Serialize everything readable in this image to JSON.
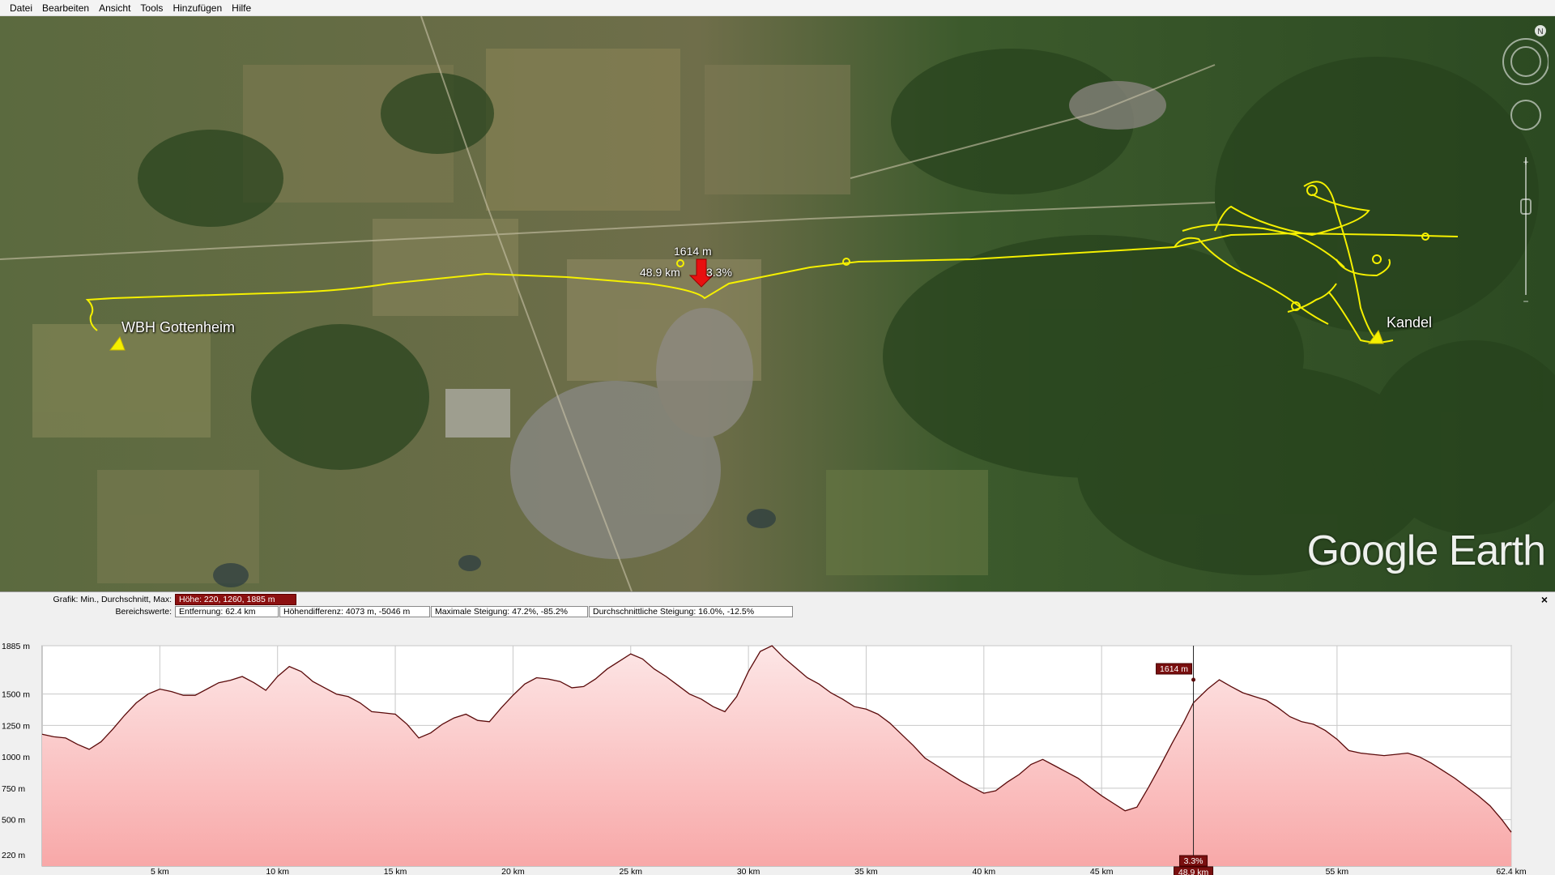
{
  "menu": {
    "items": [
      {
        "label": "Datei",
        "name": "menu-datei"
      },
      {
        "label": "Bearbeiten",
        "name": "menu-bearbeiten"
      },
      {
        "label": "Ansicht",
        "name": "menu-ansicht"
      },
      {
        "label": "Tools",
        "name": "menu-tools"
      },
      {
        "label": "Hinzufügen",
        "name": "menu-hinzufuegen"
      },
      {
        "label": "Hilfe",
        "name": "menu-hilfe"
      }
    ]
  },
  "map": {
    "places": {
      "start": "WBH Gottenheim",
      "end": "Kandel"
    },
    "cursor": {
      "elevation": "1614 m",
      "distance": "48.9 km",
      "slope": "3.3%"
    },
    "watermark": "Google Earth",
    "compass_letter": "N",
    "track_color": "#f5f000",
    "cursor_color": "#e81010"
  },
  "profile": {
    "row1": {
      "label": "Grafik: Min., Durchschnitt, Max:",
      "hoehe": "Höhe: 220, 1260, 1885 m"
    },
    "row2": {
      "label": "Bereichswerte:",
      "entfernung": "Entfernung: 62.4 km",
      "hoehendifferenz": "Höhendifferenz: 4073 m, -5046 m",
      "max_steigung": "Maximale Steigung: 47.2%, -85.2%",
      "avg_steigung": "Durchschnittliche Steigung: 16.0%, -12.5%"
    },
    "close_symbol": "×"
  },
  "chart_data": {
    "type": "area",
    "xlabel": "",
    "ylabel": "",
    "xlim": [
      0,
      62.4
    ],
    "ylim": [
      130,
      1885
    ],
    "y_ticks": [
      {
        "label": "1885 m",
        "value": 1885
      },
      {
        "label": "1500 m",
        "value": 1500
      },
      {
        "label": "1250 m",
        "value": 1250
      },
      {
        "label": "1000 m",
        "value": 1000
      },
      {
        "label": "750 m",
        "value": 750
      },
      {
        "label": "500 m",
        "value": 500
      },
      {
        "label": "220 m",
        "value": 220
      }
    ],
    "x_ticks": [
      {
        "label": "5 km",
        "value": 5
      },
      {
        "label": "10 km",
        "value": 10
      },
      {
        "label": "15 km",
        "value": 15
      },
      {
        "label": "20 km",
        "value": 20
      },
      {
        "label": "25 km",
        "value": 25
      },
      {
        "label": "30 km",
        "value": 30
      },
      {
        "label": "35 km",
        "value": 35
      },
      {
        "label": "40 km",
        "value": 40
      },
      {
        "label": "45 km",
        "value": 45
      },
      {
        "label": "55 km",
        "value": 55
      },
      {
        "label": "62.4 km",
        "value": 62.4
      }
    ],
    "cursor": {
      "x": 48.9,
      "y": 1614,
      "x_label": "48.9 km",
      "y_label": "1614 m",
      "slope_label": "3.3%"
    },
    "grid": true,
    "line_color": "#5a0a0a",
    "fill_top": "#fde6e6",
    "fill_bottom": "#f8a8a8",
    "x": [
      0,
      0.5,
      1,
      1.5,
      2,
      2.5,
      3,
      3.5,
      4,
      4.5,
      5,
      5.5,
      6,
      6.5,
      7,
      7.5,
      8,
      8.5,
      9,
      9.5,
      10,
      10.5,
      11,
      11.5,
      12,
      12.5,
      13,
      13.5,
      14,
      14.5,
      15,
      15.5,
      16,
      16.5,
      17,
      17.5,
      18,
      18.5,
      19,
      19.5,
      20,
      20.5,
      21,
      21.5,
      22,
      22.5,
      23,
      23.5,
      24,
      24.5,
      25,
      25.5,
      26,
      26.5,
      27,
      27.5,
      28,
      28.5,
      29,
      29.5,
      30,
      30.5,
      31,
      31.5,
      32,
      32.5,
      33,
      33.5,
      34,
      34.5,
      35,
      35.5,
      36,
      36.5,
      37,
      37.5,
      38,
      38.5,
      39,
      39.5,
      40,
      40.5,
      41,
      41.5,
      42,
      42.5,
      43,
      43.5,
      44,
      44.5,
      45,
      45.5,
      46,
      46.5,
      47,
      47.5,
      48,
      48.5,
      48.9,
      49.5,
      50,
      50.5,
      51,
      51.5,
      52,
      52.5,
      53,
      53.5,
      54,
      54.5,
      55,
      55.5,
      56,
      56.5,
      57,
      57.5,
      58,
      58.5,
      59,
      59.5,
      60,
      60.5,
      61,
      61.5,
      62,
      62.4
    ],
    "y": [
      1180,
      1160,
      1150,
      1100,
      1060,
      1120,
      1220,
      1330,
      1430,
      1500,
      1540,
      1520,
      1490,
      1490,
      1540,
      1590,
      1610,
      1640,
      1590,
      1530,
      1640,
      1720,
      1680,
      1600,
      1550,
      1500,
      1480,
      1430,
      1360,
      1350,
      1340,
      1260,
      1150,
      1190,
      1260,
      1310,
      1340,
      1290,
      1280,
      1390,
      1490,
      1580,
      1630,
      1620,
      1600,
      1550,
      1560,
      1620,
      1700,
      1760,
      1820,
      1780,
      1700,
      1640,
      1570,
      1500,
      1460,
      1400,
      1360,
      1480,
      1680,
      1840,
      1885,
      1790,
      1710,
      1630,
      1580,
      1510,
      1460,
      1400,
      1380,
      1340,
      1270,
      1180,
      1090,
      990,
      930,
      870,
      810,
      760,
      710,
      730,
      800,
      860,
      940,
      980,
      930,
      880,
      830,
      760,
      690,
      630,
      570,
      600,
      760,
      930,
      1110,
      1280,
      1430,
      1540,
      1614,
      1560,
      1510,
      1480,
      1450,
      1390,
      1320,
      1280,
      1260,
      1210,
      1140,
      1050,
      1030,
      1020,
      1010,
      1020,
      1030,
      1000,
      950,
      890,
      830,
      760,
      690,
      610,
      500,
      400,
      300,
      210
    ]
  }
}
